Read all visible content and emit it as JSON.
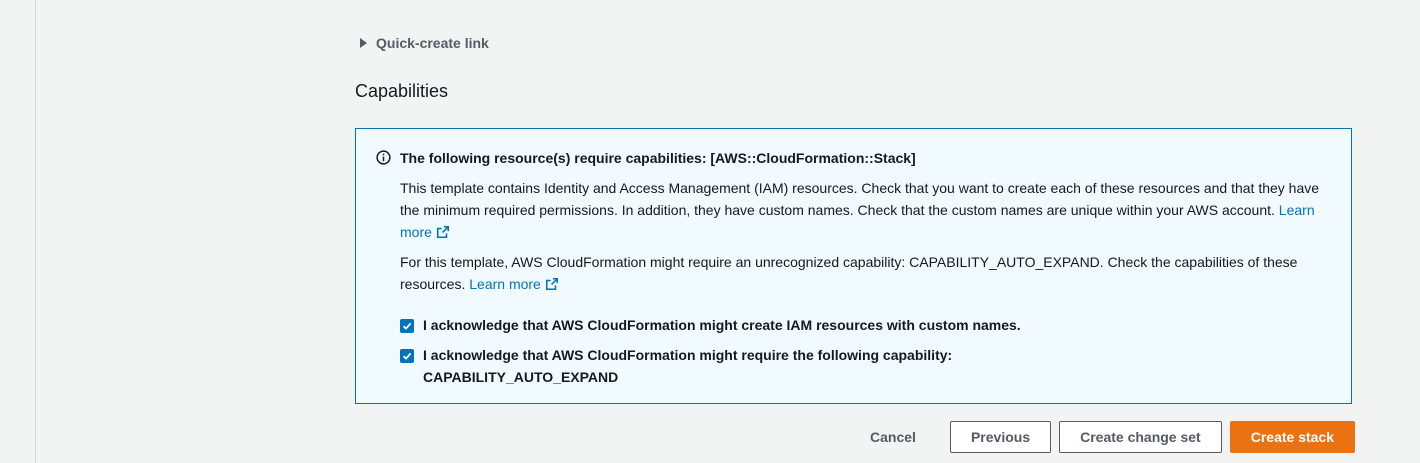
{
  "expander": {
    "label": "Quick-create link"
  },
  "capabilities": {
    "title": "Capabilities",
    "alert": {
      "title": "The following resource(s) require capabilities: [AWS::CloudFormation::Stack]",
      "para1_text": "This template contains Identity and Access Management (IAM) resources. Check that you want to create each of these resources and that they have the minimum required permissions. In addition, they have custom names. Check that the custom names are unique within your AWS account.",
      "para1_link": "Learn more",
      "para2_text": "For this template, AWS CloudFormation might require an unrecognized capability: CAPABILITY_AUTO_EXPAND. Check the capabilities of these resources.",
      "para2_link": "Learn more",
      "ack1": {
        "label": "I acknowledge that AWS CloudFormation might create IAM resources with custom names.",
        "checked": true
      },
      "ack2": {
        "label": "I acknowledge that AWS CloudFormation might require the following capability:",
        "detail": "CAPABILITY_AUTO_EXPAND",
        "checked": true
      }
    }
  },
  "footer": {
    "cancel": "Cancel",
    "previous": "Previous",
    "create_change_set": "Create change set",
    "create_stack": "Create stack"
  },
  "colors": {
    "accent": "#0073bb",
    "primary_button": "#ec7211",
    "alert_bg": "#f1faff"
  }
}
